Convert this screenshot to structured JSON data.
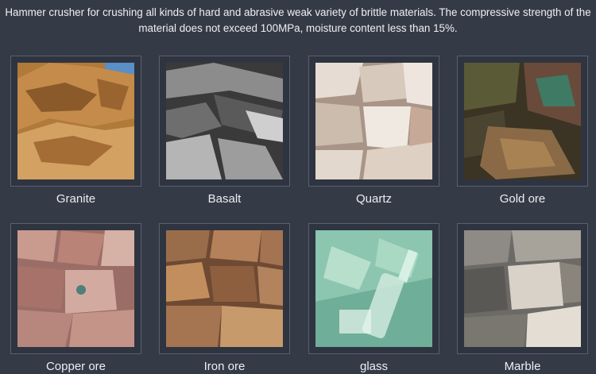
{
  "intro": {
    "line1": "Hammer crusher for crushing all kinds of hard and abrasive weak variety of brittle materials. The compressive strength of the",
    "line2": "material does not exceed 100MPa, moisture content less than 15%."
  },
  "materials": [
    {
      "label": "Granite",
      "icon": "granite-photo"
    },
    {
      "label": "Basalt",
      "icon": "basalt-photo"
    },
    {
      "label": "Quartz",
      "icon": "quartz-photo"
    },
    {
      "label": "Gold ore",
      "icon": "gold-ore-photo"
    },
    {
      "label": "Copper ore",
      "icon": "copper-ore-photo"
    },
    {
      "label": "Iron ore",
      "icon": "iron-ore-photo"
    },
    {
      "label": "glass",
      "icon": "glass-photo"
    },
    {
      "label": "Marble",
      "icon": "marble-photo"
    }
  ]
}
